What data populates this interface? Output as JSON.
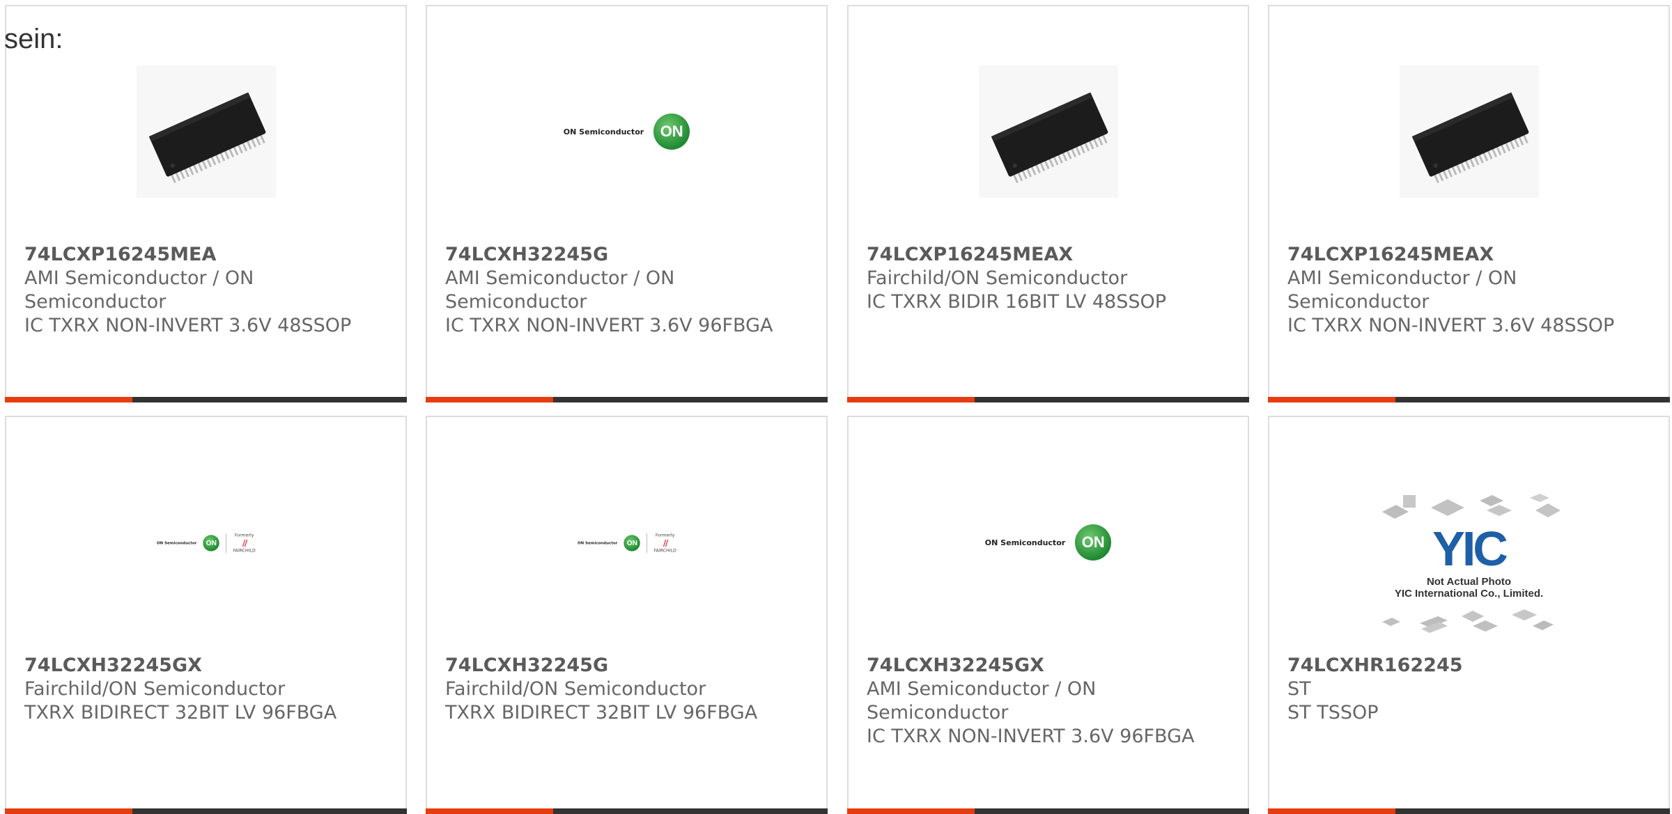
{
  "intro_text": "sein:",
  "colors": {
    "accent": "#e63c10",
    "bar": "#333333",
    "border": "#dddddd",
    "text": "#666666"
  },
  "cards": [
    {
      "part_number": "74LCXP16245MEA",
      "manufacturer": "AMI Semiconductor / ON Semiconductor",
      "description": "IC TXRX NON-INVERT 3.6V 48SSOP",
      "image": "chip-48ssop"
    },
    {
      "part_number": "74LCXH32245G",
      "manufacturer": "AMI Semiconductor / ON Semiconductor",
      "description": "IC TXRX NON-INVERT 3.6V 96FBGA",
      "image": "on-semiconductor-logo",
      "logo_text": "ON Semiconductor",
      "badge_text": "ON"
    },
    {
      "part_number": "74LCXP16245MEAX",
      "manufacturer": "Fairchild/ON Semiconductor",
      "description": "IC TXRX BIDIR 16BIT LV 48SSOP",
      "image": "chip-48ssop"
    },
    {
      "part_number": "74LCXP16245MEAX",
      "manufacturer": "AMI Semiconductor / ON Semiconductor",
      "description": "IC TXRX NON-INVERT 3.6V 48SSOP",
      "image": "chip-48ssop"
    },
    {
      "part_number": "74LCXH32245GX",
      "manufacturer": "Fairchild/ON Semiconductor",
      "description": "TXRX BIDIRECT 32BIT LV 96FBGA",
      "image": "on-fairchild-logo",
      "logo_text": "ON Semiconductor",
      "badge_text": "ON",
      "fairchild_text": "FAIRCHILD",
      "formerly_text": "Formerly"
    },
    {
      "part_number": "74LCXH32245G",
      "manufacturer": "Fairchild/ON Semiconductor",
      "description": "TXRX BIDIRECT 32BIT LV 96FBGA",
      "image": "on-fairchild-logo",
      "logo_text": "ON Semiconductor",
      "badge_text": "ON",
      "fairchild_text": "FAIRCHILD",
      "formerly_text": "Formerly"
    },
    {
      "part_number": "74LCXH32245GX",
      "manufacturer": "AMI Semiconductor / ON Semiconductor",
      "description": "IC TXRX NON-INVERT 3.6V 96FBGA",
      "image": "on-semiconductor-logo",
      "logo_text": "ON Semiconductor",
      "badge_text": "ON"
    },
    {
      "part_number": "74LCXHR162245",
      "manufacturer": "ST",
      "description": "ST TSSOP",
      "image": "yic-placeholder",
      "yic_caption1": "Not Actual Photo",
      "yic_caption2": "YIC International Co., Limited."
    }
  ]
}
